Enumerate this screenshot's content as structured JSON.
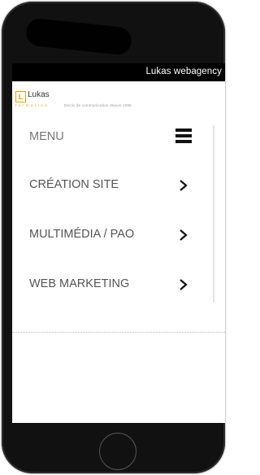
{
  "statusbar": {
    "title": "Lukas webagency"
  },
  "header": {
    "logo_letter": "L",
    "logo_name": "Lukas",
    "logo_sub": "formation",
    "tagline": "Déclic de communication depuis 1995"
  },
  "menu": {
    "title": "MENU",
    "toggle_icon": "hamburger-icon",
    "items": [
      {
        "label": "CRÉATION SITE",
        "icon": "chevron-right-icon"
      },
      {
        "label": "MULTIMÉDIA / PAO",
        "icon": "chevron-right-icon"
      },
      {
        "label": "WEB MARKETING",
        "icon": "chevron-right-icon"
      }
    ]
  },
  "colors": {
    "accent": "#e5a100",
    "statusbar_bg": "#000000",
    "text": "#555555"
  }
}
